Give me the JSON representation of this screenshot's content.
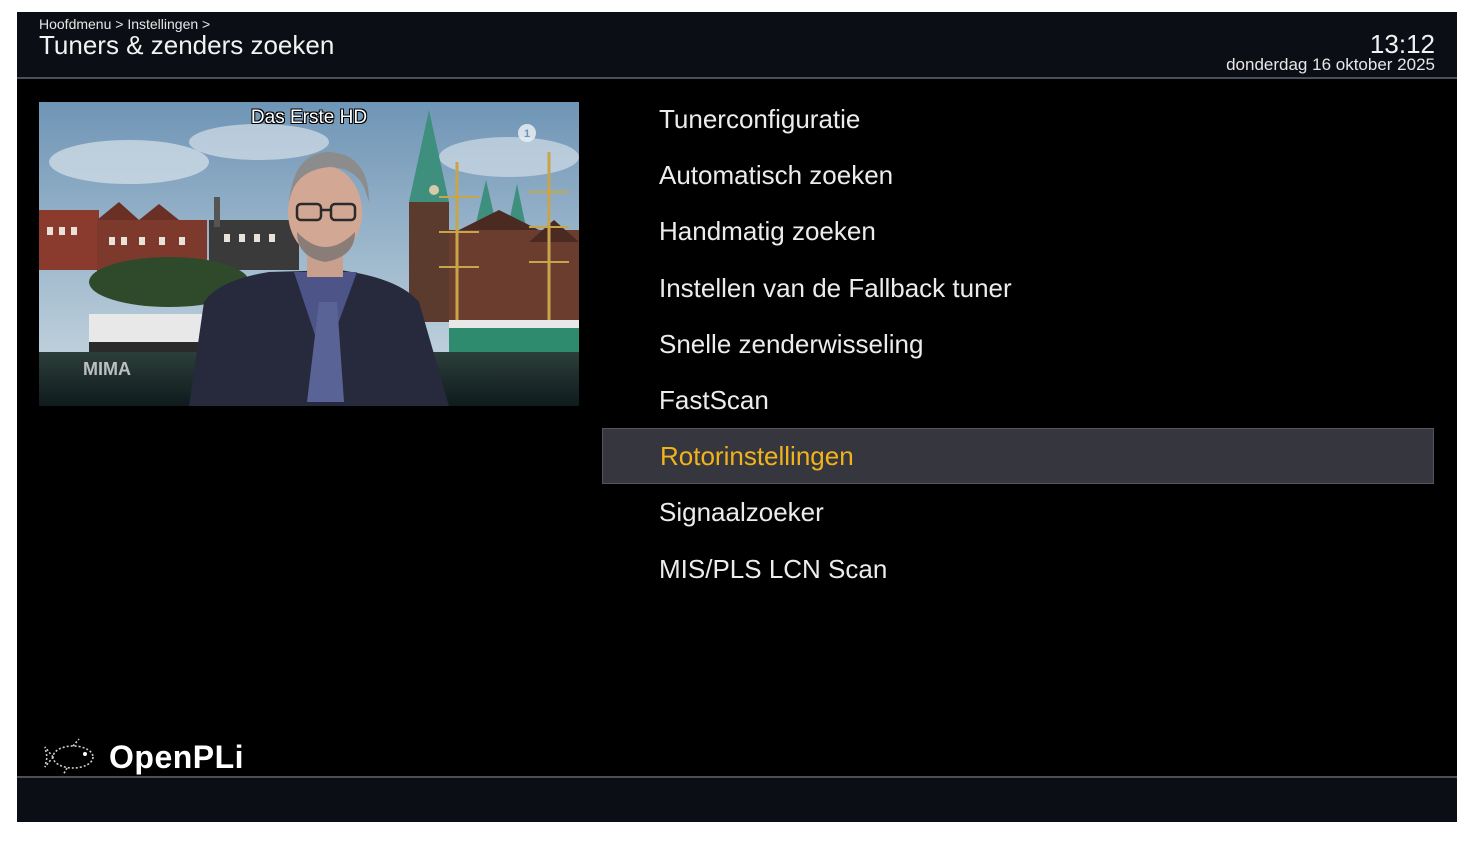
{
  "header": {
    "breadcrumb": "Hoofdmenu > Instellingen >",
    "title": "Tuners & zenders zoeken",
    "time": "13:12",
    "date": "donderdag 16 oktober 2025"
  },
  "preview": {
    "channel": "Das Erste HD",
    "watermark": "MIMA",
    "broadcaster_icon": "ard-one-icon"
  },
  "menu": {
    "items": [
      {
        "label": "Tunerconfiguratie"
      },
      {
        "label": "Automatisch zoeken"
      },
      {
        "label": "Handmatig zoeken"
      },
      {
        "label": "Instellen van de Fallback tuner"
      },
      {
        "label": "Snelle zenderwisseling"
      },
      {
        "label": "FastScan"
      },
      {
        "label": "Rotorinstellingen"
      },
      {
        "label": "Signaalzoeker"
      },
      {
        "label": "MIS/PLS LCN Scan"
      }
    ],
    "selected_index": 6
  },
  "footer": {
    "logo_text": "OpenPLi",
    "logo_icon": "openpli-fish-icon"
  },
  "colors": {
    "background": "#000000",
    "header_bar": "#0b0f15",
    "selection_bg": "#36363f",
    "selection_text": "#f1b31c",
    "menu_text": "#ececec"
  }
}
